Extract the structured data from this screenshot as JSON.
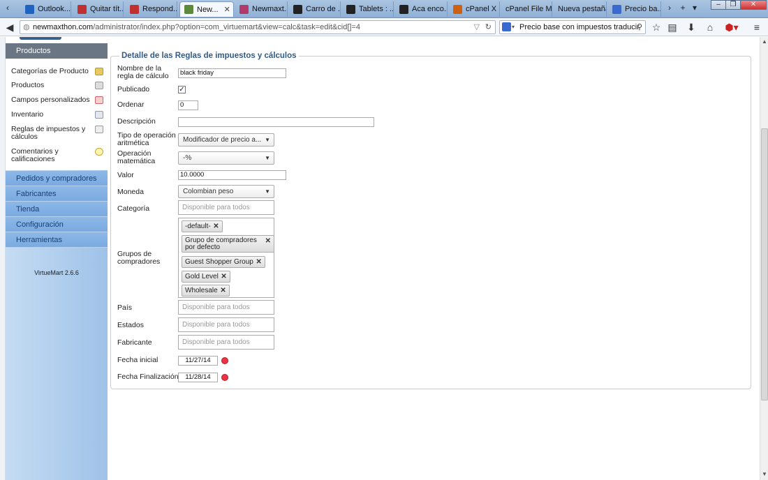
{
  "browser": {
    "tabs": [
      {
        "label": "Outlook....",
        "color": "#1e63c0"
      },
      {
        "label": "Quitar tít...",
        "color": "#c03030"
      },
      {
        "label": "Respond...",
        "color": "#c03030"
      },
      {
        "label": "New...",
        "color": "#5a8a3a"
      },
      {
        "label": "Newmaxt...",
        "color": "#b03a6a"
      },
      {
        "label": "Carro de ...",
        "color": "#222"
      },
      {
        "label": "Tablets : ...",
        "color": "#222"
      },
      {
        "label": "Aca enco...",
        "color": "#222"
      },
      {
        "label": "cPanel X ...",
        "color": "#d06010"
      },
      {
        "label": "cPanel File M...",
        "color": "#d06010"
      },
      {
        "label": "Nueva pestaña",
        "color": ""
      },
      {
        "label": "Precio ba...",
        "color": "#3a6ad0"
      }
    ],
    "url_domain": "newmaxthon.com",
    "url_path": "/administrator/index.php?option=com_virtuemart&view=calc&task=edit&cid[]=4",
    "search_value": "Precio base con impuestos traducir"
  },
  "sidebar": {
    "products_header": "Productos",
    "sub_items": [
      {
        "label": "Categorías de Producto",
        "icon": "folder-icon"
      },
      {
        "label": "Productos",
        "icon": "products-icon"
      },
      {
        "label": "Campos personalizados",
        "icon": "custom-fields-icon"
      },
      {
        "label": "Inventario",
        "icon": "inventory-icon"
      },
      {
        "label": "Reglas de impuestos y cálculos",
        "icon": "calculator-icon"
      },
      {
        "label": "Comentarios y calificaciones",
        "icon": "comment-icon"
      }
    ],
    "sections": [
      "Pedidos y compradores",
      "Fabricantes",
      "Tienda",
      "Configuración",
      "Herramientas"
    ],
    "version": "VirtueMart 2.6.6"
  },
  "form": {
    "legend": "Detalle de las Reglas de impuestos y cálculos",
    "name_label": "Nombre de la regla de cálculo",
    "name_value": "black friday",
    "published_label": "Publicado",
    "published_checked": "✓",
    "order_label": "Ordenar",
    "order_value": "0",
    "description_label": "Descripción",
    "description_value": "",
    "op_type_label": "Tipo de operación aritmética",
    "op_type_value": "Modificador de precio a...",
    "math_op_label": "Operación matemática",
    "math_op_value": "-%",
    "value_label": "Valor",
    "value_value": "10.0000",
    "currency_label": "Moneda",
    "currency_value": "Colombian peso",
    "category_label": "Categoría",
    "category_placeholder": "Disponible para todos",
    "groups_label": "Grupos de compradores",
    "groups": [
      "-default-",
      "Grupo de compradores por defecto",
      "Guest Shopper Group",
      "Gold Level",
      "Wholesale"
    ],
    "country_label": "País",
    "country_placeholder": "Disponible para todos",
    "states_label": "Estados",
    "states_placeholder": "Disponible para todos",
    "manufacturer_label": "Fabricante",
    "manufacturer_placeholder": "Disponible para todos",
    "start_label": "Fecha inicial",
    "start_value": "11/27/14",
    "end_label": "Fecha Finalización",
    "end_value": "11/28/14"
  }
}
